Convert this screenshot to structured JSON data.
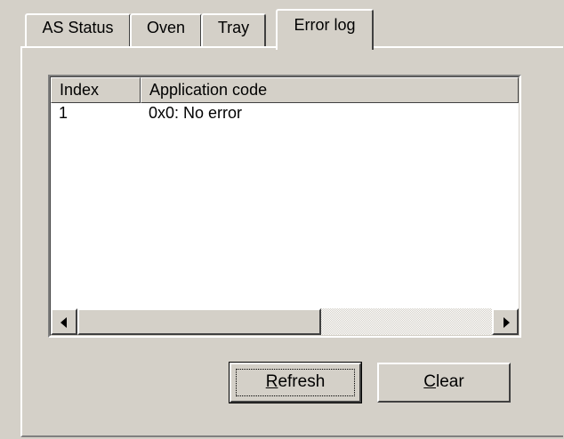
{
  "tabs": [
    {
      "label": "AS Status",
      "active": false
    },
    {
      "label": "Oven",
      "active": false
    },
    {
      "label": "Tray",
      "active": false
    },
    {
      "label": "Error log",
      "active": true
    }
  ],
  "error_log": {
    "columns": [
      "Index",
      "Application code"
    ],
    "rows": [
      {
        "index": "1",
        "code": "0x0: No error"
      }
    ]
  },
  "buttons": {
    "refresh": {
      "mnemonic": "R",
      "rest": "efresh",
      "label": "Refresh"
    },
    "clear": {
      "mnemonic": "C",
      "rest": "lear",
      "label": "Clear"
    }
  },
  "icons": {
    "scroll_left": "scroll-left-arrow-icon",
    "scroll_right": "scroll-right-arrow-icon"
  },
  "colors": {
    "face": "#d4d0c8",
    "highlight": "#ffffff",
    "shadow": "#808080",
    "dark_shadow": "#404040"
  }
}
